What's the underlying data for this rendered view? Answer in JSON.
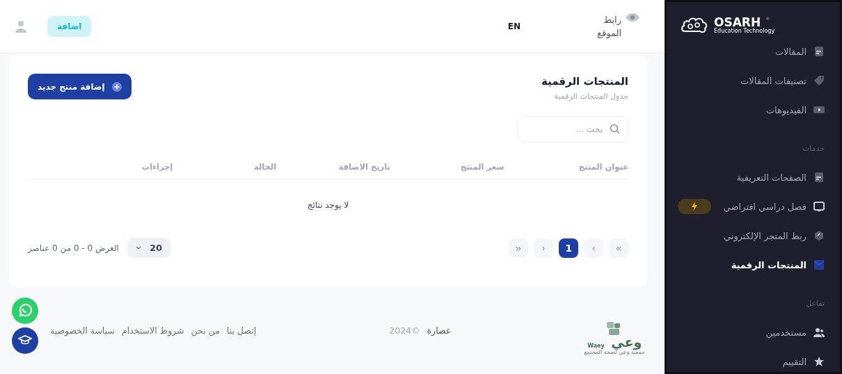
{
  "sidebar": {
    "logo": {
      "name": "OSARH",
      "registered": "®",
      "tagline": "Education Technology"
    },
    "groups": [
      {
        "items": [
          {
            "label": "المقالات",
            "selected": false
          },
          {
            "label": "تصنيفات المقالات",
            "selected": false
          },
          {
            "label": "الفيديوهات",
            "selected": false
          }
        ]
      },
      {
        "heading": "خدمات",
        "items": [
          {
            "label": "الصفحات التعريفية",
            "selected": false
          },
          {
            "label": "فصل دراسي افتراضي",
            "selected": false,
            "badge": true
          },
          {
            "label": "ربط المتجر الإلكتروني",
            "selected": false
          },
          {
            "label": "المنتجات الرقمية",
            "selected": true
          }
        ]
      },
      {
        "heading": "تفاعل",
        "items": [
          {
            "label": "مستخدمين",
            "selected": false
          },
          {
            "label": "التقييم",
            "selected": false
          }
        ]
      }
    ]
  },
  "topbar": {
    "site_link": "رابط الموقع",
    "language": "EN",
    "add_button": "اضافة"
  },
  "card": {
    "title": "المنتجات الرقمية",
    "subtitle": "جدول المنتجات الرقمية",
    "add_button": "إضافة منتج جديد",
    "search": {
      "placeholder": "بحث ..."
    },
    "table": {
      "columns": [
        "عنوان المنتج",
        "سعر المنتج",
        "تاريخ الاضافة",
        "الحالة",
        "إجراءات"
      ],
      "empty": "لا يوجد نتائج"
    },
    "pagination": {
      "pages": [
        {
          "label": "»",
          "selected": false
        },
        {
          "label": "›",
          "selected": false
        },
        {
          "label": "1",
          "selected": true
        },
        {
          "label": "‹",
          "selected": false
        },
        {
          "label": "«",
          "selected": false
        }
      ],
      "page_size": "20",
      "summary": "العرض 0 - 0 من 0 عناصر"
    }
  },
  "footer": {
    "logo": {
      "name": "وعي",
      "latin": "Waey",
      "tagline": "جمعية وعي لصحة المجتمع"
    },
    "copyright": "©2024",
    "company": "عصارة",
    "links": [
      "إتصل بنا",
      "من نحن",
      "شروط الاستخدام",
      "سياسة الخصوصية"
    ]
  }
}
